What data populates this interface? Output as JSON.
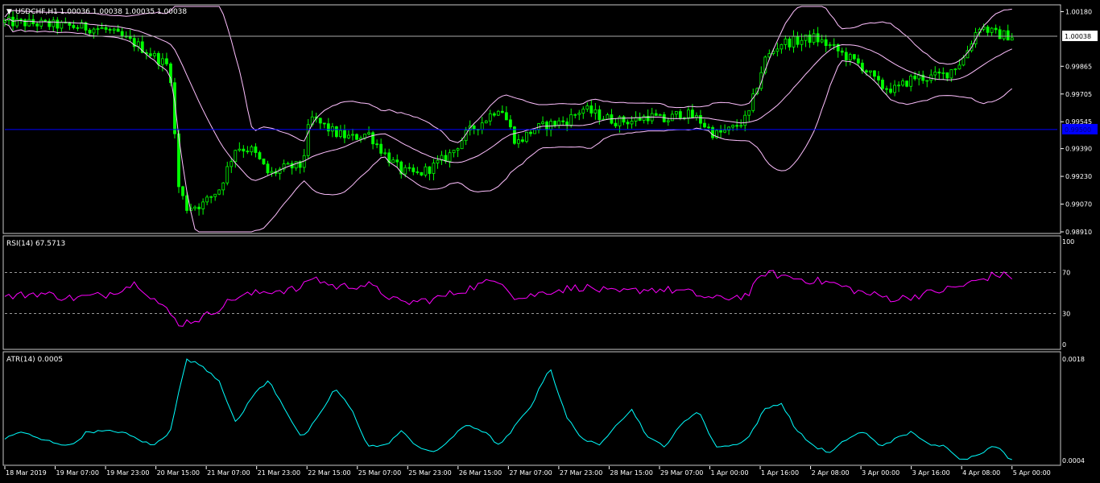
{
  "chart_data": [
    {
      "type": "candlestick",
      "panel": "price",
      "symbol_label": "USDCHF,H1  1.00036 1.00038 1.00035 1.00038",
      "ylim": [
        0.9891,
        1.0021
      ],
      "y_ticks": [
        "1.00180",
        "0.99865",
        "0.99705",
        "0.99545",
        "0.99390",
        "0.99230",
        "0.99070",
        "0.98910"
      ],
      "current_price_label": "1.00038",
      "current_price": 1.00038,
      "blue_line_label": "0.99500",
      "blue_line": 0.995,
      "indicators": [
        "Bollinger Bands"
      ],
      "colors": {
        "candles": "#00ff00",
        "bands": "#ffc0ff",
        "price_line": "#aaaaaa",
        "blue_line": "#0000ff"
      },
      "anchors": [
        [
          0,
          1.0012
        ],
        [
          2,
          1.0011
        ],
        [
          4,
          1.00095
        ],
        [
          6,
          1.0008
        ],
        [
          8,
          0.9999
        ],
        [
          10,
          0.9986
        ],
        [
          10.5,
          0.9918
        ],
        [
          11,
          0.9905
        ],
        [
          12,
          0.9907
        ],
        [
          13,
          0.9916
        ],
        [
          14,
          0.994
        ],
        [
          15,
          0.9938
        ],
        [
          16,
          0.9924
        ],
        [
          17,
          0.9928
        ],
        [
          18,
          0.9929
        ],
        [
          18.5,
          0.9957
        ],
        [
          19,
          0.9954
        ],
        [
          20,
          0.9948
        ],
        [
          21,
          0.9945
        ],
        [
          22,
          0.9948
        ],
        [
          23,
          0.9936
        ],
        [
          24,
          0.9926
        ],
        [
          25,
          0.9924
        ],
        [
          26,
          0.9929
        ],
        [
          27,
          0.9936
        ],
        [
          28,
          0.9948
        ],
        [
          29,
          0.9955
        ],
        [
          30,
          0.9964
        ],
        [
          31,
          0.9942
        ],
        [
          32,
          0.995
        ],
        [
          33,
          0.9953
        ],
        [
          34,
          0.9955
        ],
        [
          35,
          0.9962
        ],
        [
          36,
          0.9958
        ],
        [
          37,
          0.9955
        ],
        [
          38,
          0.9955
        ],
        [
          39,
          0.9958
        ],
        [
          40,
          0.9955
        ],
        [
          41,
          0.996
        ],
        [
          42,
          0.9956
        ],
        [
          43,
          0.9947
        ],
        [
          44,
          0.995
        ],
        [
          45,
          0.9957
        ],
        [
          46,
          0.999
        ],
        [
          47,
          1.0
        ],
        [
          48,
          1.0001
        ],
        [
          49,
          1.0003
        ],
        [
          50,
          0.9998
        ],
        [
          51,
          0.9992
        ],
        [
          52,
          0.9986
        ],
        [
          53,
          0.9975
        ],
        [
          54,
          0.9973
        ],
        [
          55,
          0.998
        ],
        [
          56,
          0.998
        ],
        [
          57,
          0.9982
        ],
        [
          58,
          0.999
        ],
        [
          59,
          1.001
        ],
        [
          60,
          1.0005
        ],
        [
          61,
          1.0004
        ]
      ]
    },
    {
      "type": "line",
      "panel": "rsi",
      "label": "RSI(14) 67.5713",
      "ylim": [
        0,
        100
      ],
      "y_ticks": [
        "100",
        "70",
        "30",
        "0"
      ],
      "levels": [
        70,
        30
      ],
      "colors": {
        "line": "#ff00ff",
        "levels": "#cccccc"
      },
      "anchors": [
        [
          0,
          46
        ],
        [
          2,
          50
        ],
        [
          4,
          45
        ],
        [
          6,
          48
        ],
        [
          8,
          60
        ],
        [
          10,
          30
        ],
        [
          10.5,
          20
        ],
        [
          12,
          26
        ],
        [
          14,
          46
        ],
        [
          16,
          52
        ],
        [
          18,
          54
        ],
        [
          18.5,
          66
        ],
        [
          20,
          56
        ],
        [
          22,
          58
        ],
        [
          24,
          40
        ],
        [
          26,
          44
        ],
        [
          28,
          54
        ],
        [
          30,
          64
        ],
        [
          31,
          44
        ],
        [
          33,
          52
        ],
        [
          35,
          56
        ],
        [
          37,
          50
        ],
        [
          39,
          54
        ],
        [
          41,
          52
        ],
        [
          43,
          44
        ],
        [
          45,
          48
        ],
        [
          46,
          70
        ],
        [
          48,
          64
        ],
        [
          50,
          60
        ],
        [
          52,
          50
        ],
        [
          54,
          44
        ],
        [
          56,
          50
        ],
        [
          58,
          57
        ],
        [
          60,
          68
        ],
        [
          61,
          66
        ]
      ]
    },
    {
      "type": "line",
      "panel": "atr",
      "label": "ATR(14) 0.0005",
      "ylim": [
        0.0004,
        0.0018
      ],
      "y_ticks": [
        "0.0018",
        "0.0004"
      ],
      "colors": {
        "line": "#00ffff"
      },
      "anchors": [
        [
          0,
          0.0007
        ],
        [
          1,
          0.0008
        ],
        [
          2,
          0.0007
        ],
        [
          3,
          0.00065
        ],
        [
          4,
          0.0006
        ],
        [
          5,
          0.0008
        ],
        [
          6,
          0.0008
        ],
        [
          7,
          0.0008
        ],
        [
          8,
          0.0007
        ],
        [
          9,
          0.0006
        ],
        [
          10,
          0.0008
        ],
        [
          11,
          0.0018
        ],
        [
          12,
          0.0017
        ],
        [
          13,
          0.0015
        ],
        [
          14,
          0.0009
        ],
        [
          15,
          0.0013
        ],
        [
          16,
          0.0015
        ],
        [
          17,
          0.0011
        ],
        [
          18,
          0.0007
        ],
        [
          19,
          0.001
        ],
        [
          20,
          0.0014
        ],
        [
          21,
          0.0011
        ],
        [
          22,
          0.0006
        ],
        [
          23,
          0.0006
        ],
        [
          24,
          0.0008
        ],
        [
          25,
          0.0006
        ],
        [
          26,
          0.0005
        ],
        [
          27,
          0.0007
        ],
        [
          28,
          0.0009
        ],
        [
          29,
          0.0008
        ],
        [
          30,
          0.0006
        ],
        [
          31,
          0.0009
        ],
        [
          32,
          0.0012
        ],
        [
          33,
          0.0017
        ],
        [
          34,
          0.001
        ],
        [
          35,
          0.0007
        ],
        [
          36,
          0.0006
        ],
        [
          37,
          0.0009
        ],
        [
          38,
          0.0011
        ],
        [
          39,
          0.0007
        ],
        [
          40,
          0.0006
        ],
        [
          41,
          0.0009
        ],
        [
          42,
          0.0011
        ],
        [
          43,
          0.0006
        ],
        [
          44,
          0.0006
        ],
        [
          45,
          0.0007
        ],
        [
          46,
          0.0011
        ],
        [
          47,
          0.0012
        ],
        [
          48,
          0.0008
        ],
        [
          49,
          0.0006
        ],
        [
          50,
          0.0005
        ],
        [
          51,
          0.0007
        ],
        [
          52,
          0.0008
        ],
        [
          53,
          0.0006
        ],
        [
          54,
          0.0007
        ],
        [
          55,
          0.0008
        ],
        [
          56,
          0.0006
        ],
        [
          57,
          0.0006
        ],
        [
          58,
          0.0004
        ],
        [
          59,
          0.0005
        ],
        [
          60,
          0.0006
        ],
        [
          61,
          0.0004
        ]
      ]
    }
  ],
  "x_axis": {
    "labels": [
      "18 Mar 2019",
      "19 Mar 07:00",
      "19 Mar 23:00",
      "20 Mar 15:00",
      "21 Mar 07:00",
      "21 Mar 23:00",
      "22 Mar 15:00",
      "25 Mar 07:00",
      "25 Mar 23:00",
      "26 Mar 15:00",
      "27 Mar 07:00",
      "27 Mar 23:00",
      "28 Mar 15:00",
      "29 Mar 07:00",
      "1 Apr 00:00",
      "1 Apr 16:00",
      "2 Apr 08:00",
      "3 Apr 00:00",
      "3 Apr 16:00",
      "4 Apr 08:00",
      "5 Apr 00:00"
    ]
  }
}
